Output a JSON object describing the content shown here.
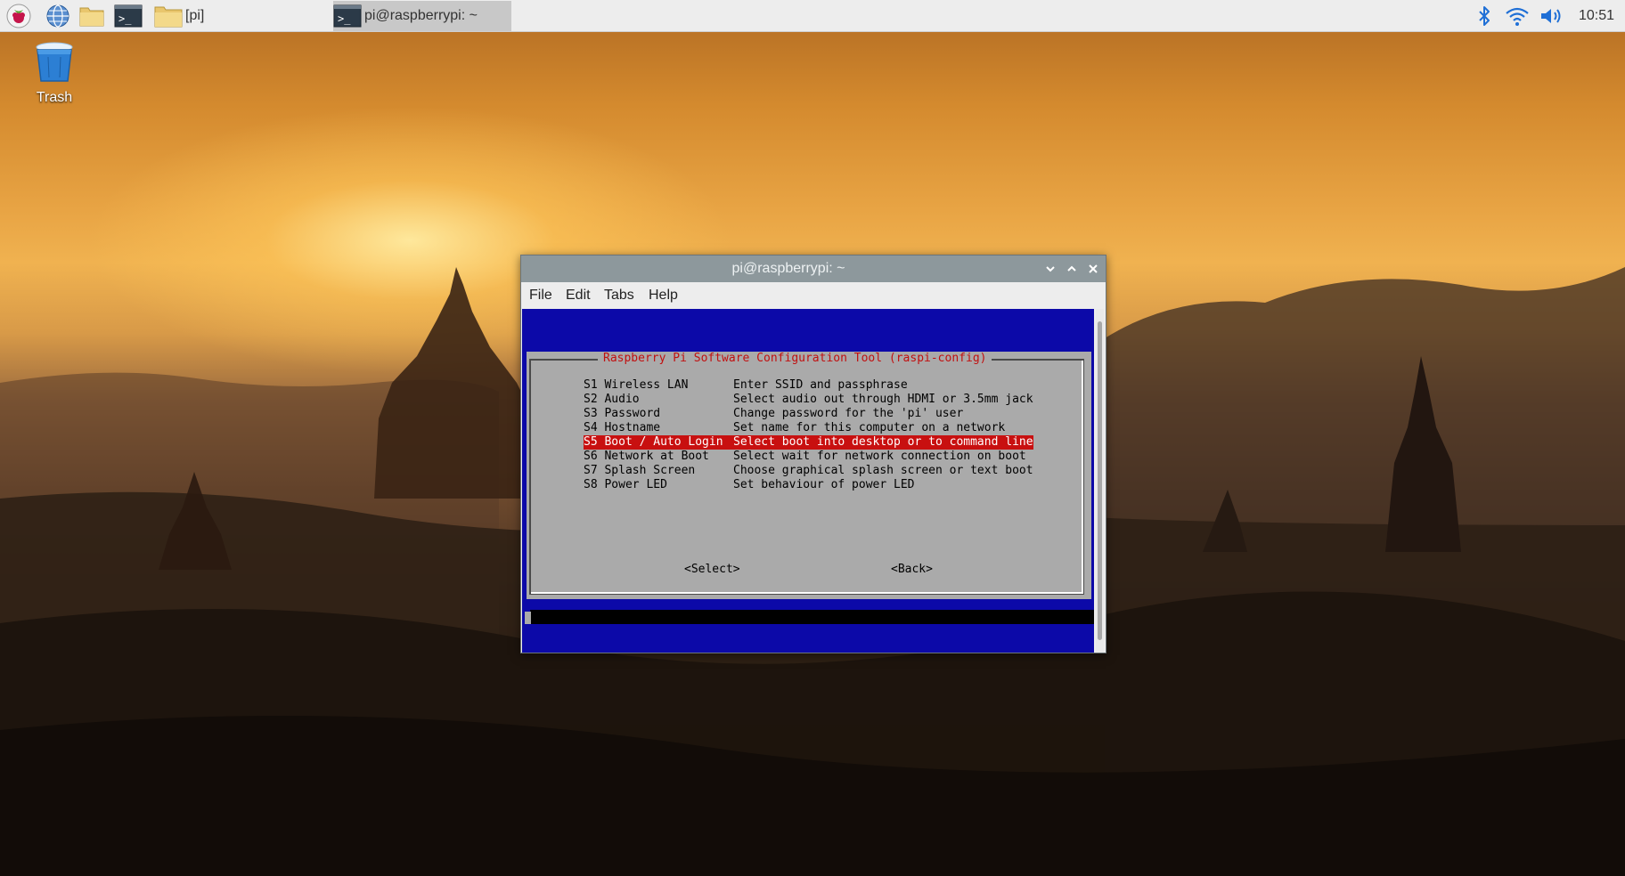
{
  "taskbar": {
    "tasks": [
      {
        "label": "[pi]"
      },
      {
        "label": "pi@raspberrypi: ~"
      }
    ],
    "clock": "10:51"
  },
  "desktop": {
    "trash_label": "Trash"
  },
  "window": {
    "title": "pi@raspberrypi: ~",
    "menu": [
      "File",
      "Edit",
      "Tabs",
      "Help"
    ]
  },
  "raspi_config": {
    "title": "Raspberry Pi Software Configuration Tool (raspi-config)",
    "options": [
      {
        "code": "S1 Wireless LAN",
        "desc": "Enter SSID and passphrase"
      },
      {
        "code": "S2 Audio",
        "desc": "Select audio out through HDMI or 3.5mm jack"
      },
      {
        "code": "S3 Password",
        "desc": "Change password for the 'pi' user"
      },
      {
        "code": "S4 Hostname",
        "desc": "Set name for this computer on a network"
      },
      {
        "code": "S5 Boot / Auto Login",
        "desc": "Select boot into desktop or to command line"
      },
      {
        "code": "S6 Network at Boot",
        "desc": "Select wait for network connection on boot"
      },
      {
        "code": "S7 Splash Screen",
        "desc": "Choose graphical splash screen or text boot"
      },
      {
        "code": "S8 Power LED",
        "desc": "Set behaviour of power LED"
      }
    ],
    "selected_index": 4,
    "buttons": {
      "select": "<Select>",
      "back": "<Back>"
    }
  },
  "colors": {
    "terminal_bg": "#0c09a8",
    "dialog_bg": "#aaaaaa",
    "title_text": "#c11010",
    "selection": "#c81010"
  }
}
